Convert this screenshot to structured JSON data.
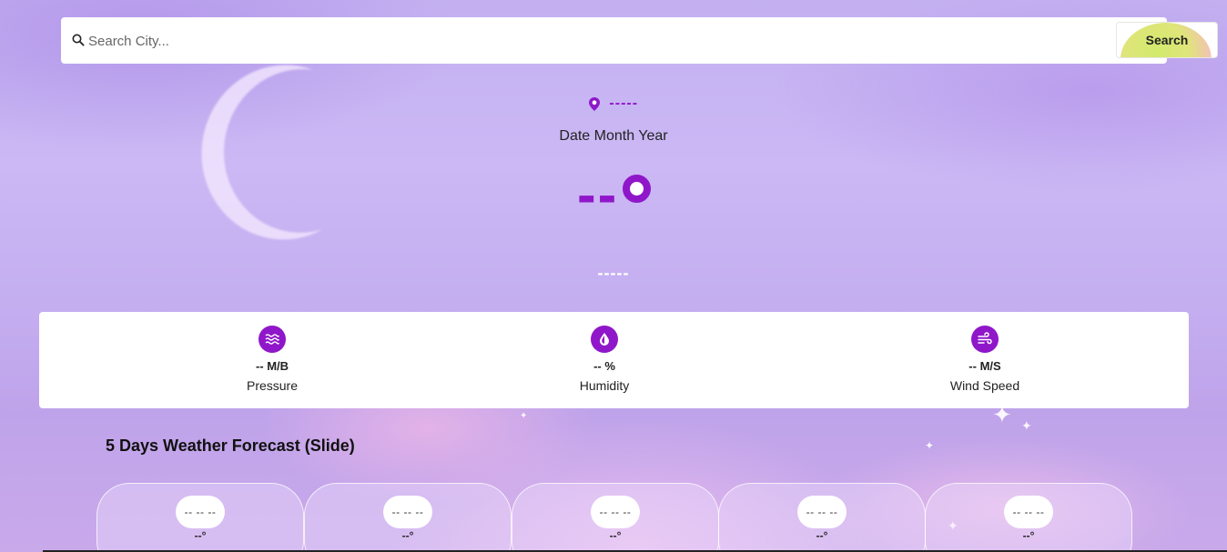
{
  "search": {
    "placeholder": "Search City...",
    "button_label": "Search"
  },
  "location": {
    "name": "-----"
  },
  "date": "Date Month Year",
  "current": {
    "temperature": "--",
    "condition": "-----"
  },
  "stats": [
    {
      "icon": "pressure-waves-icon",
      "value": "-- M/B",
      "label": "Pressure"
    },
    {
      "icon": "humidity-drop-icon",
      "value": "-- %",
      "label": "Humidity"
    },
    {
      "icon": "wind-icon",
      "value": "-- M/S",
      "label": "Wind Speed"
    }
  ],
  "forecast": {
    "title": "5 Days Weather Forecast (Slide)",
    "days": [
      {
        "day": "-- -- --",
        "temp": "--°"
      },
      {
        "day": "-- -- --",
        "temp": "--°"
      },
      {
        "day": "-- -- --",
        "temp": "--°"
      },
      {
        "day": "-- -- --",
        "temp": "--°"
      },
      {
        "day": "-- -- --",
        "temp": "--°"
      }
    ]
  },
  "colors": {
    "accent": "#8f17c9",
    "background": "#c3b0f1",
    "card": "#ffffff"
  }
}
